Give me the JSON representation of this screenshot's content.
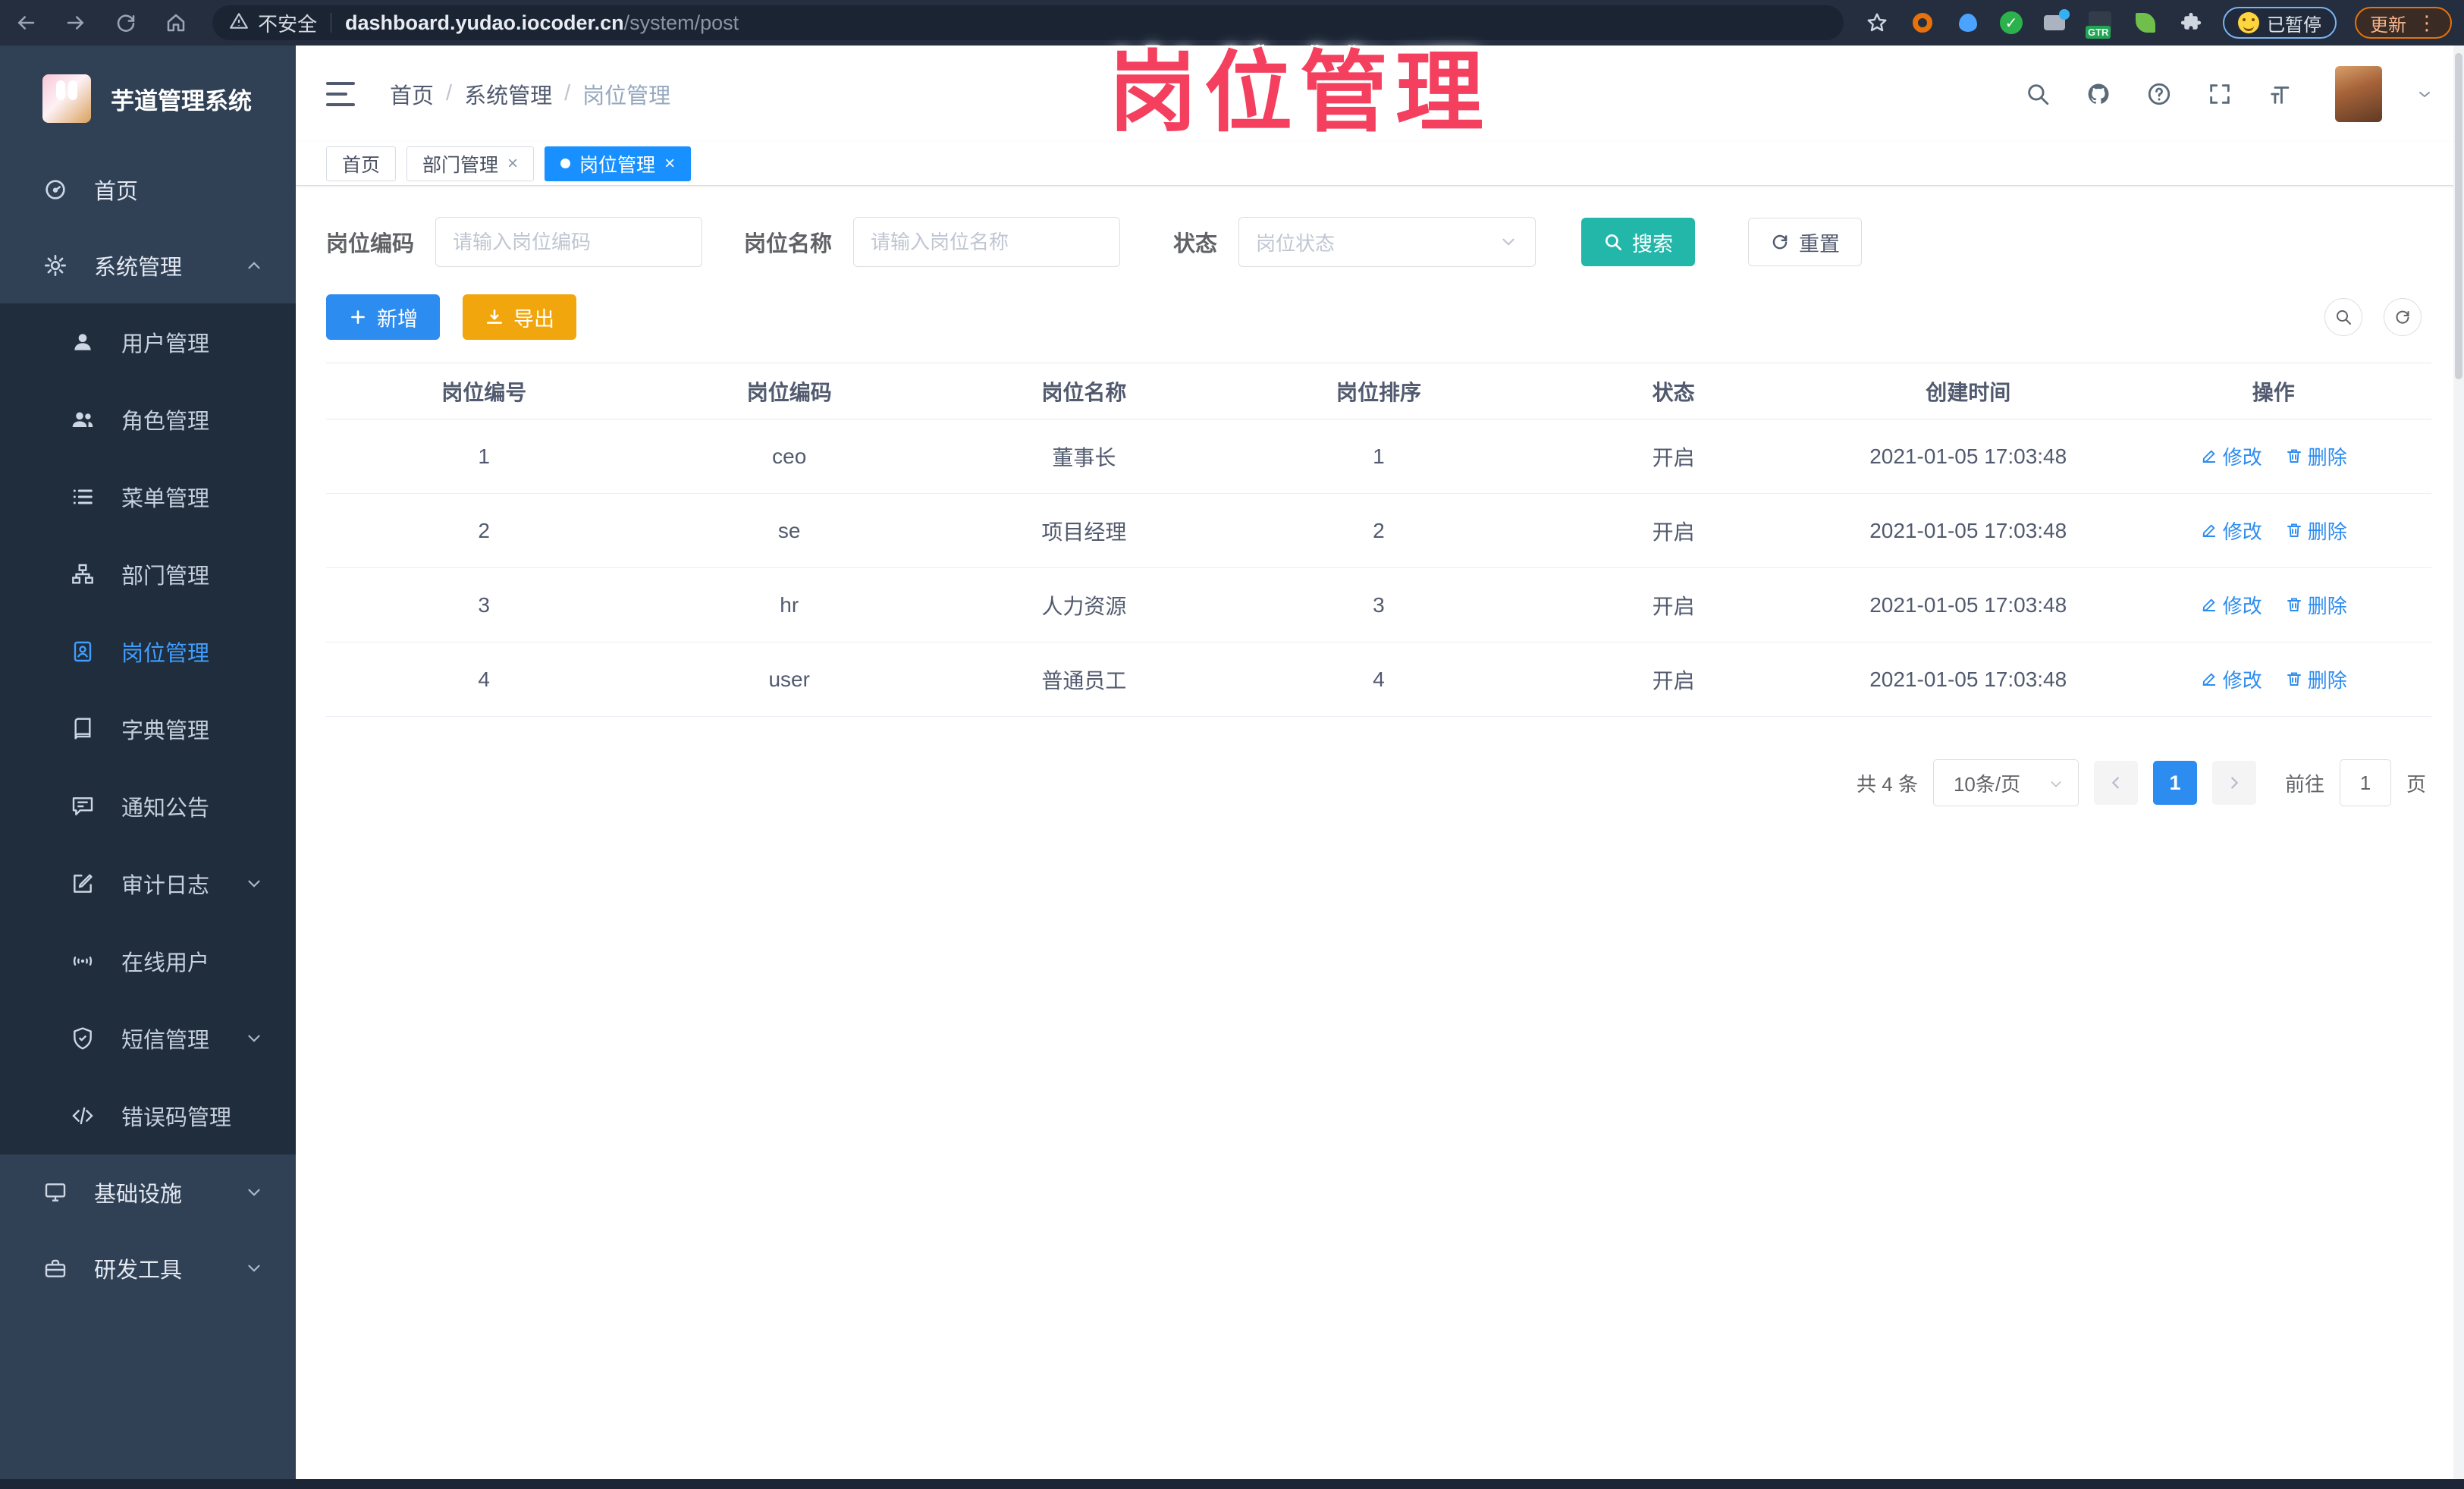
{
  "colors": {
    "accent_blue": "#2d8cf0",
    "tab_active_blue": "#1890ff",
    "search_teal": "#23b7a9",
    "export_orange": "#f2a60d",
    "sidebar_bg": "#304156",
    "submenu_bg": "#1f2d3d",
    "active_menu_blue": "#409eff",
    "overlay_red": "#f43f5e"
  },
  "browser": {
    "security_label": "不安全",
    "url_host": "dashboard.yudao.iocoder.cn",
    "url_path": "/system/post",
    "extension_badge": "GTR",
    "paused_badge_label": "已暂停",
    "update_button_label": "更新"
  },
  "overlay": {
    "title": "岗位管理"
  },
  "sidebar": {
    "app_title": "芋道管理系统",
    "top_items": [
      {
        "label": "首页",
        "icon": "dashboard-icon"
      },
      {
        "label": "系统管理",
        "icon": "gear-icon",
        "chevron": "up"
      }
    ],
    "system_children": [
      {
        "label": "用户管理",
        "icon": "user-icon"
      },
      {
        "label": "角色管理",
        "icon": "role-icon"
      },
      {
        "label": "菜单管理",
        "icon": "menu-list-icon"
      },
      {
        "label": "部门管理",
        "icon": "dept-tree-icon"
      },
      {
        "label": "岗位管理",
        "icon": "post-badge-icon",
        "active": true
      },
      {
        "label": "字典管理",
        "icon": "dict-book-icon"
      },
      {
        "label": "通知公告",
        "icon": "notice-icon"
      },
      {
        "label": "审计日志",
        "icon": "audit-log-icon",
        "chevron": "down"
      },
      {
        "label": "在线用户",
        "icon": "online-user-icon"
      },
      {
        "label": "短信管理",
        "icon": "sms-shield-icon",
        "chevron": "down"
      },
      {
        "label": "错误码管理",
        "icon": "error-code-icon"
      }
    ],
    "bottom_items": [
      {
        "label": "基础设施",
        "icon": "infra-monitor-icon",
        "chevron": "down"
      },
      {
        "label": "研发工具",
        "icon": "dev-tools-icon",
        "chevron": "down"
      }
    ]
  },
  "header": {
    "breadcrumb": [
      "首页",
      "系统管理",
      "岗位管理"
    ]
  },
  "tabs": [
    {
      "label": "首页",
      "closable": false,
      "active": false
    },
    {
      "label": "部门管理",
      "closable": true,
      "active": false
    },
    {
      "label": "岗位管理",
      "closable": true,
      "active": true
    }
  ],
  "filters": {
    "code_label": "岗位编码",
    "code_placeholder": "请输入岗位编码",
    "name_label": "岗位名称",
    "name_placeholder": "请输入岗位名称",
    "status_label": "状态",
    "status_placeholder": "岗位状态",
    "search_label": "搜索",
    "reset_label": "重置"
  },
  "toolbar": {
    "add_label": "新增",
    "export_label": "导出"
  },
  "table": {
    "columns": [
      "岗位编号",
      "岗位编码",
      "岗位名称",
      "岗位排序",
      "状态",
      "创建时间",
      "操作"
    ],
    "rows": [
      {
        "id": "1",
        "code": "ceo",
        "name": "董事长",
        "sort": "1",
        "status": "开启",
        "created": "2021-01-05 17:03:48"
      },
      {
        "id": "2",
        "code": "se",
        "name": "项目经理",
        "sort": "2",
        "status": "开启",
        "created": "2021-01-05 17:03:48"
      },
      {
        "id": "3",
        "code": "hr",
        "name": "人力资源",
        "sort": "3",
        "status": "开启",
        "created": "2021-01-05 17:03:48"
      },
      {
        "id": "4",
        "code": "user",
        "name": "普通员工",
        "sort": "4",
        "status": "开启",
        "created": "2021-01-05 17:03:48"
      }
    ],
    "edit_label": "修改",
    "delete_label": "删除"
  },
  "pagination": {
    "total_label": "共 4 条",
    "page_size_label": "10条/页",
    "current_page": "1",
    "goto_label": "前往",
    "goto_value": "1",
    "page_unit_label": "页"
  }
}
